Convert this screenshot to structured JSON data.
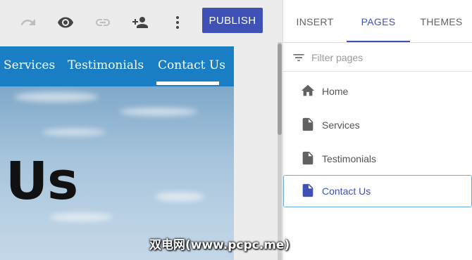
{
  "toolbar": {
    "publish_label": "PUBLISH",
    "icons": [
      "redo-icon",
      "preview-icon",
      "link-icon",
      "share-icon",
      "more-icon"
    ]
  },
  "site": {
    "nav": [
      "Services",
      "Testimonials",
      "Contact Us"
    ],
    "active_nav": "Contact Us",
    "hero_title": "Us"
  },
  "panel": {
    "tabs": [
      {
        "label": "INSERT",
        "active": false
      },
      {
        "label": "PAGES",
        "active": true
      },
      {
        "label": "THEMES",
        "active": false
      }
    ],
    "filter_placeholder": "Filter pages",
    "pages": [
      {
        "label": "Home",
        "icon": "home-icon",
        "selected": false
      },
      {
        "label": "Services",
        "icon": "page-icon",
        "selected": false
      },
      {
        "label": "Testimonials",
        "icon": "page-icon",
        "selected": false
      },
      {
        "label": "Contact Us",
        "icon": "page-icon",
        "selected": true
      }
    ]
  },
  "colors": {
    "accent": "#3f51b5",
    "site_nav": "#1a7ec4",
    "selection_border": "#6ab0de"
  },
  "watermark": "双电网(www.pcpc.me)"
}
